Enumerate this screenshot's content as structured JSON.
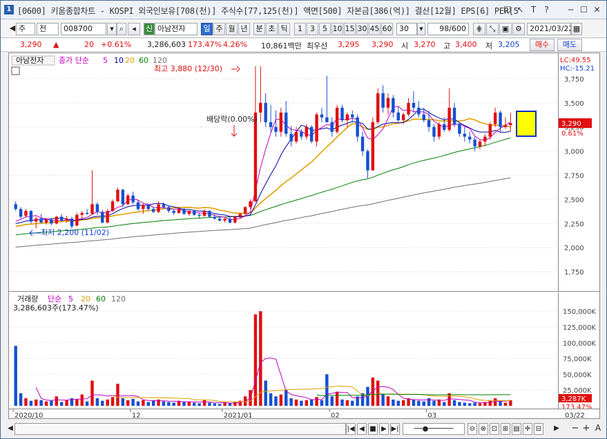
{
  "title": "[0600] 키움종합차트 - KOSPI 외국인보유[708(천)] 주식수[77,125(천)] 액면[500] 자본금[386(억)] 결산[12월] EPS[6] PER[5",
  "app_icon": "1",
  "window_controls": [
    "☐",
    "↖",
    "T",
    "?",
    "−",
    "☐",
    "✕"
  ],
  "toolbar": {
    "mode": "주",
    "prev": "전",
    "code": "008700",
    "credit_badge": "신",
    "stock_name": "아남전자",
    "periods": [
      "일",
      "주",
      "월",
      "년",
      "분",
      "초",
      "틱"
    ],
    "active_period": "일",
    "minutes": [
      "1",
      "3",
      "5",
      "10",
      "15",
      "30",
      "45",
      "60"
    ],
    "selected_minute": "30",
    "count": "98/600",
    "date": "2021/03/22"
  },
  "quote": {
    "price": "3,290",
    "arrow": "▲",
    "change": "20",
    "change_pct": "+0.61%",
    "volume": "3,286,603",
    "volume_ratio": "173.47%",
    "turnover": "4.26%",
    "amount": "10,861백만",
    "best_label": "최우선",
    "ask": "3,295",
    "bid": "3,290",
    "open_label": "시",
    "open": "3,270",
    "high_label": "고",
    "high": "3,400",
    "low_label": "저",
    "low": "3,205",
    "buy": "매수",
    "sell": "매도"
  },
  "price_panel": {
    "stock_tag": "아남전자",
    "legend_label": "종가 단순",
    "ma_labels": [
      "5",
      "10",
      "20",
      "60",
      "120"
    ],
    "ma_colors": [
      "#c000c0",
      "#0000a0",
      "#e0a000",
      "#008000",
      "#707070"
    ],
    "lc": "LC:49.55",
    "hc": "HC:-15.21",
    "high_annot": "최고 3,880 (12/30)",
    "low_annot": "최저 2,200 (11/02)",
    "dividend_annot": "배당락(0.00%)",
    "axis_ticks": [
      "3,750",
      "3,500",
      "3,250",
      "3,000",
      "2,750",
      "2,500",
      "2,250",
      "2,000",
      "1,750"
    ],
    "current_price_tag": "3,290",
    "current_pct_tag": "0.61%"
  },
  "volume_panel": {
    "legend_label": "거래량",
    "legend_ma": "단순",
    "ma_labels": [
      "5",
      "20",
      "60",
      "120"
    ],
    "ma_colors": [
      "#c000c0",
      "#e0a000",
      "#008000",
      "#707070"
    ],
    "value_text": "3,286,603주(173.47%)",
    "axis_ticks": [
      "150,000K",
      "125,000K",
      "100,000K",
      "75,000K",
      "50,000K",
      "25,000K"
    ],
    "current_vol_tag": "3,287K",
    "current_pct_tag": "173.47%"
  },
  "date_axis": {
    "labels": [
      "2020/10",
      "12",
      "2021/01",
      "02",
      "03"
    ],
    "right_label": "03/22"
  },
  "chart_data": {
    "type": "candlestick",
    "price_range": [
      1600,
      3900
    ],
    "volume_range": [
      0,
      160000
    ],
    "candles": [
      [
        2450,
        2480,
        2380,
        2400
      ],
      [
        2400,
        2420,
        2300,
        2320
      ],
      [
        2330,
        2400,
        2310,
        2380
      ],
      [
        2380,
        2390,
        2250,
        2270
      ],
      [
        2270,
        2320,
        2200,
        2300
      ],
      [
        2300,
        2350,
        2250,
        2260
      ],
      [
        2260,
        2300,
        2240,
        2290
      ],
      [
        2290,
        2310,
        2230,
        2250
      ],
      [
        2250,
        2330,
        2240,
        2320
      ],
      [
        2320,
        2350,
        2270,
        2280
      ],
      [
        2280,
        2330,
        2260,
        2300
      ],
      [
        2300,
        2320,
        2200,
        2220
      ],
      [
        2230,
        2360,
        2220,
        2340
      ],
      [
        2340,
        2380,
        2300,
        2360
      ],
      [
        2360,
        2400,
        2340,
        2350
      ],
      [
        2350,
        2800,
        2350,
        2450
      ],
      [
        2450,
        2470,
        2340,
        2370
      ],
      [
        2370,
        2390,
        2250,
        2260
      ],
      [
        2260,
        2400,
        2250,
        2380
      ],
      [
        2380,
        2500,
        2370,
        2480
      ],
      [
        2480,
        2620,
        2470,
        2600
      ],
      [
        2600,
        2610,
        2420,
        2450
      ],
      [
        2450,
        2560,
        2440,
        2540
      ],
      [
        2540,
        2580,
        2450,
        2470
      ],
      [
        2470,
        2490,
        2380,
        2400
      ],
      [
        2400,
        2460,
        2350,
        2440
      ],
      [
        2440,
        2450,
        2380,
        2400
      ],
      [
        2400,
        2420,
        2360,
        2370
      ],
      [
        2370,
        2480,
        2360,
        2450
      ],
      [
        2450,
        2470,
        2400,
        2420
      ],
      [
        2420,
        2440,
        2360,
        2380
      ],
      [
        2380,
        2400,
        2340,
        2360
      ],
      [
        2360,
        2420,
        2350,
        2400
      ],
      [
        2400,
        2410,
        2340,
        2350
      ],
      [
        2350,
        2390,
        2330,
        2380
      ],
      [
        2380,
        2390,
        2330,
        2340
      ],
      [
        2340,
        2360,
        2310,
        2330
      ],
      [
        2330,
        2400,
        2320,
        2380
      ],
      [
        2380,
        2390,
        2310,
        2320
      ],
      [
        2320,
        2350,
        2290,
        2300
      ],
      [
        2300,
        2330,
        2270,
        2280
      ],
      [
        2280,
        2310,
        2260,
        2300
      ],
      [
        2300,
        2320,
        2250,
        2260
      ],
      [
        2260,
        2330,
        2250,
        2320
      ],
      [
        2320,
        2360,
        2300,
        2350
      ],
      [
        2350,
        2430,
        2340,
        2420
      ],
      [
        2420,
        2500,
        2400,
        2480
      ],
      [
        2480,
        3880,
        2470,
        3400
      ],
      [
        3400,
        3880,
        3300,
        3500
      ],
      [
        3500,
        3600,
        3250,
        3300
      ],
      [
        3300,
        3480,
        3200,
        3250
      ],
      [
        3250,
        3420,
        3150,
        3200
      ],
      [
        3200,
        3450,
        3150,
        3400
      ],
      [
        3400,
        3520,
        3150,
        3180
      ],
      [
        3180,
        3260,
        3050,
        3100
      ],
      [
        3100,
        3250,
        3080,
        3200
      ],
      [
        3200,
        3230,
        3120,
        3150
      ],
      [
        3150,
        3280,
        3120,
        3250
      ],
      [
        3250,
        3270,
        3080,
        3100
      ],
      [
        3100,
        3400,
        3050,
        3380
      ],
      [
        3380,
        3450,
        3300,
        3350
      ],
      [
        3350,
        3780,
        3300,
        3300
      ],
      [
        3300,
        3350,
        3150,
        3200
      ],
      [
        3200,
        3480,
        3180,
        3450
      ],
      [
        3450,
        3480,
        3300,
        3320
      ],
      [
        3320,
        3400,
        3250,
        3380
      ],
      [
        3380,
        3420,
        3300,
        3350
      ],
      [
        3350,
        3380,
        3100,
        3150
      ],
      [
        3150,
        3200,
        2950,
        3000
      ],
      [
        3000,
        3020,
        2720,
        2800
      ],
      [
        2800,
        3350,
        2800,
        3300
      ],
      [
        3300,
        3650,
        3280,
        3600
      ],
      [
        3600,
        3680,
        3400,
        3450
      ],
      [
        3450,
        3600,
        3380,
        3550
      ],
      [
        3550,
        3580,
        3350,
        3400
      ],
      [
        3400,
        3460,
        3300,
        3320
      ],
      [
        3320,
        3400,
        3280,
        3380
      ],
      [
        3380,
        3550,
        3360,
        3500
      ],
      [
        3500,
        3620,
        3400,
        3450
      ],
      [
        3450,
        3520,
        3350,
        3380
      ],
      [
        3380,
        3450,
        3300,
        3320
      ],
      [
        3320,
        3420,
        3200,
        3250
      ],
      [
        3250,
        3280,
        3100,
        3150
      ],
      [
        3150,
        3300,
        3120,
        3280
      ],
      [
        3280,
        3350,
        3200,
        3220
      ],
      [
        3220,
        3650,
        3200,
        3450
      ],
      [
        3450,
        3500,
        3250,
        3280
      ],
      [
        3280,
        3300,
        3150,
        3180
      ],
      [
        3180,
        3250,
        3100,
        3150
      ],
      [
        3150,
        3200,
        3080,
        3120
      ],
      [
        3120,
        3150,
        3000,
        3050
      ],
      [
        3050,
        3120,
        3020,
        3100
      ],
      [
        3100,
        3180,
        3050,
        3150
      ],
      [
        3150,
        3300,
        3120,
        3280
      ],
      [
        3280,
        3450,
        3250,
        3400
      ],
      [
        3400,
        3420,
        3200,
        3250
      ],
      [
        3250,
        3350,
        3230,
        3270
      ],
      [
        3270,
        3400,
        3205,
        3290
      ]
    ],
    "volumes": [
      95000,
      20000,
      12000,
      8000,
      10000,
      9000,
      7000,
      8000,
      15000,
      6000,
      9000,
      12000,
      10000,
      18000,
      7000,
      40000,
      12000,
      8000,
      10000,
      14000,
      35000,
      12000,
      9000,
      11000,
      7000,
      9000,
      6000,
      8000,
      10000,
      7000,
      6000,
      5000,
      8000,
      6000,
      7000,
      5000,
      4000,
      9000,
      5000,
      4000,
      3000,
      5000,
      4000,
      6000,
      8000,
      15000,
      25000,
      145000,
      150000,
      40000,
      20000,
      15000,
      18000,
      25000,
      12000,
      10000,
      8000,
      9000,
      10000,
      14000,
      9000,
      50000,
      15000,
      22000,
      10000,
      9000,
      8000,
      15000,
      20000,
      30000,
      45000,
      40000,
      18000,
      15000,
      10000,
      8000,
      9000,
      12000,
      10000,
      8000,
      7000,
      12000,
      8000,
      10000,
      6000,
      20000,
      9000,
      6000,
      5000,
      4000,
      5000,
      4000,
      6000,
      8000,
      12000,
      7000,
      5000,
      9000
    ]
  }
}
